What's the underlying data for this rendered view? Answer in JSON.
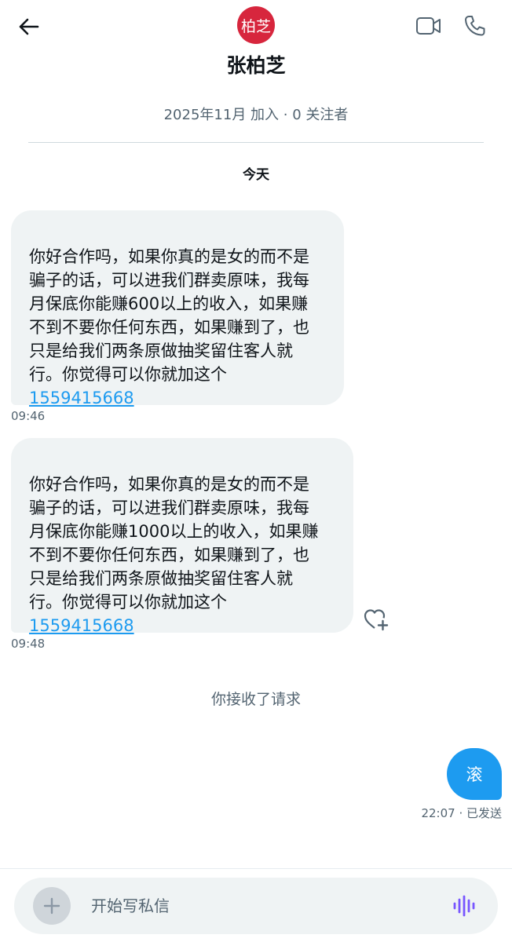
{
  "header": {
    "avatar_text": "柏芝",
    "avatar_color": "#d7263d",
    "name": "张柏芝",
    "back_icon": "arrow-left-icon",
    "video_icon": "video-camera-icon",
    "phone_icon": "phone-icon"
  },
  "profile": {
    "joined": "2025年11月 加入 · 0 关注者"
  },
  "day_label": "今天",
  "messages": [
    {
      "text": "你好合作吗，如果你真的是女的而不是\n骗子的话，可以进我们群卖原味，我每\n月保底你能赚600以上的收入，如果赚\n不到不要你任何东西，如果赚到了，也\n只是给我们两条原做抽奖留住客人就\n行。你觉得可以你就加这个",
      "link": "1559415668",
      "time": "09:46"
    },
    {
      "text": "你好合作吗，如果你真的是女的而不是\n骗子的话，可以进我们群卖原味，我每\n月保底你能赚1000以上的收入，如果赚\n不到不要你任何东西，如果赚到了，也\n只是给我们两条原做抽奖留住客人就\n行。你觉得可以你就加这个",
      "link": "1559415668",
      "time": "09:48"
    }
  ],
  "request_accepted": "你接收了请求",
  "outgoing": {
    "text": "滚",
    "status": "22:07 · 已发送"
  },
  "composer": {
    "placeholder": "开始写私信",
    "add_icon": "plus-icon",
    "voice_icon": "voice-waveform-icon"
  },
  "colors": {
    "accent": "#1d9bf0",
    "bubble_incoming": "#eff3f4",
    "secondary_text": "#536471",
    "voice_icon": "#7856ff"
  }
}
